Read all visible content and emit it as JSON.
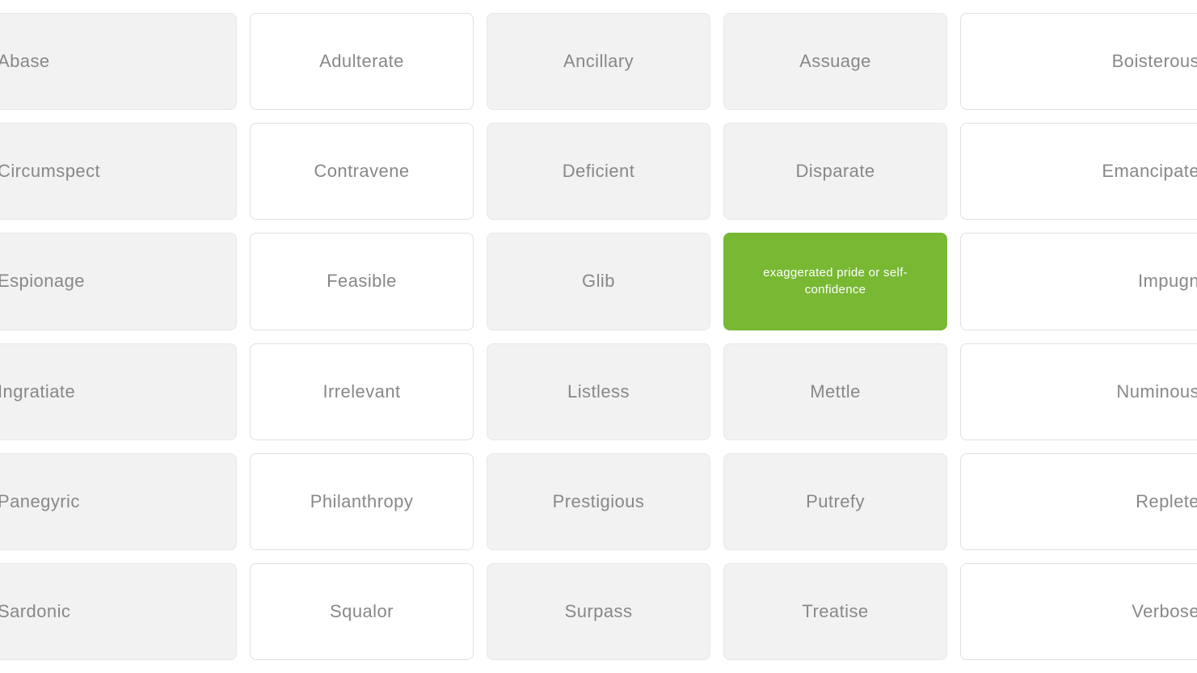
{
  "grid": {
    "columns": 5,
    "rows": 6,
    "cells": [
      {
        "id": "r0c0",
        "label": "Abase",
        "style": "left-clip",
        "row": 0,
        "col": 0
      },
      {
        "id": "r0c1",
        "label": "Adulterate",
        "style": "white",
        "row": 0,
        "col": 1
      },
      {
        "id": "r0c2",
        "label": "Ancillary",
        "style": "default",
        "row": 0,
        "col": 2
      },
      {
        "id": "r0c3",
        "label": "Assuage",
        "style": "default",
        "row": 0,
        "col": 3
      },
      {
        "id": "r0c4",
        "label": "Boisterous",
        "style": "right-clip",
        "row": 0,
        "col": 4
      },
      {
        "id": "r1c0",
        "label": "Circumspect",
        "style": "left-clip",
        "row": 1,
        "col": 0
      },
      {
        "id": "r1c1",
        "label": "Contravene",
        "style": "white",
        "row": 1,
        "col": 1
      },
      {
        "id": "r1c2",
        "label": "Deficient",
        "style": "default",
        "row": 1,
        "col": 2
      },
      {
        "id": "r1c3",
        "label": "Disparate",
        "style": "default",
        "row": 1,
        "col": 3
      },
      {
        "id": "r1c4",
        "label": "Emancipate",
        "style": "right-clip",
        "row": 1,
        "col": 4
      },
      {
        "id": "r2c0",
        "label": "Espionage",
        "style": "left-clip",
        "row": 2,
        "col": 0
      },
      {
        "id": "r2c1",
        "label": "Feasible",
        "style": "white",
        "row": 2,
        "col": 1
      },
      {
        "id": "r2c2",
        "label": "Glib",
        "style": "default",
        "row": 2,
        "col": 2
      },
      {
        "id": "r2c3",
        "label": "exaggerated pride or self-confidence",
        "style": "green",
        "row": 2,
        "col": 3
      },
      {
        "id": "r2c4",
        "label": "Impugn",
        "style": "right-clip",
        "row": 2,
        "col": 4
      },
      {
        "id": "r3c0",
        "label": "Ingratiate",
        "style": "left-clip",
        "row": 3,
        "col": 0
      },
      {
        "id": "r3c1",
        "label": "Irrelevant",
        "style": "white",
        "row": 3,
        "col": 1
      },
      {
        "id": "r3c2",
        "label": "Listless",
        "style": "default",
        "row": 3,
        "col": 2
      },
      {
        "id": "r3c3",
        "label": "Mettle",
        "style": "default",
        "row": 3,
        "col": 3
      },
      {
        "id": "r3c4",
        "label": "Numinous",
        "style": "right-clip",
        "row": 3,
        "col": 4
      },
      {
        "id": "r4c0",
        "label": "Panegyric",
        "style": "left-clip",
        "row": 4,
        "col": 0
      },
      {
        "id": "r4c1",
        "label": "Philanthropy",
        "style": "white",
        "row": 4,
        "col": 1
      },
      {
        "id": "r4c2",
        "label": "Prestigious",
        "style": "default",
        "row": 4,
        "col": 2
      },
      {
        "id": "r4c3",
        "label": "Putrefy",
        "style": "default",
        "row": 4,
        "col": 3
      },
      {
        "id": "r4c4",
        "label": "Replete",
        "style": "right-clip",
        "row": 4,
        "col": 4
      },
      {
        "id": "r5c0",
        "label": "Sardonic",
        "style": "left-clip",
        "row": 5,
        "col": 0
      },
      {
        "id": "r5c1",
        "label": "Squalor",
        "style": "white",
        "row": 5,
        "col": 1
      },
      {
        "id": "r5c2",
        "label": "Surpass",
        "style": "default",
        "row": 5,
        "col": 2
      },
      {
        "id": "r5c3",
        "label": "Treatise",
        "style": "default",
        "row": 5,
        "col": 3
      },
      {
        "id": "r5c4",
        "label": "Verbose",
        "style": "right-clip",
        "row": 5,
        "col": 4
      }
    ]
  }
}
